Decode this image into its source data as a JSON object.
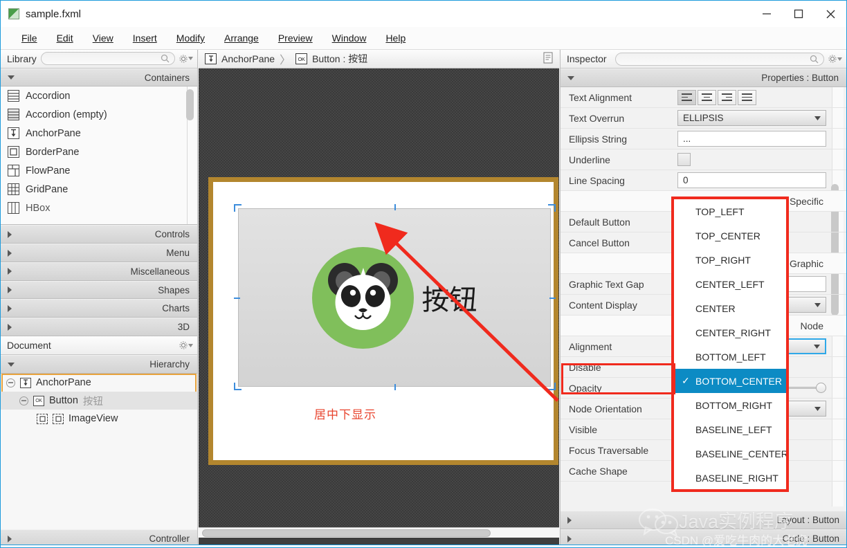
{
  "window": {
    "title": "sample.fxml",
    "icon": "fxml-file-icon",
    "minimize": "—",
    "maximize": "□",
    "close": "✕"
  },
  "menubar": {
    "items": [
      {
        "label": "File"
      },
      {
        "label": "Edit"
      },
      {
        "label": "View"
      },
      {
        "label": "Insert"
      },
      {
        "label": "Modify"
      },
      {
        "label": "Arrange"
      },
      {
        "label": "Preview"
      },
      {
        "label": "Window"
      },
      {
        "label": "Help"
      }
    ]
  },
  "library": {
    "title": "Library",
    "search_placeholder": "",
    "sections": [
      {
        "label": "Containers",
        "expanded": true
      },
      {
        "label": "Controls",
        "expanded": false
      },
      {
        "label": "Menu",
        "expanded": false
      },
      {
        "label": "Miscellaneous",
        "expanded": false
      },
      {
        "label": "Shapes",
        "expanded": false
      },
      {
        "label": "Charts",
        "expanded": false
      },
      {
        "label": "3D",
        "expanded": false
      }
    ],
    "items": [
      {
        "label": "Accordion",
        "icon": "accordion-icon"
      },
      {
        "label": "Accordion  (empty)",
        "icon": "accordion-empty-icon"
      },
      {
        "label": "AnchorPane",
        "icon": "anchorpane-icon"
      },
      {
        "label": "BorderPane",
        "icon": "borderpane-icon"
      },
      {
        "label": "FlowPane",
        "icon": "flowpane-icon"
      },
      {
        "label": "GridPane",
        "icon": "gridpane-icon"
      },
      {
        "label": "HBox",
        "icon": "hbox-icon"
      }
    ]
  },
  "document": {
    "title": "Document",
    "hierarchy_label": "Hierarchy",
    "controller_label": "Controller",
    "tree": [
      {
        "label": "AnchorPane",
        "icon": "anchorpane-icon",
        "suffix": "",
        "indent": 0,
        "selected": false,
        "expander": true
      },
      {
        "label": "Button",
        "icon": "button-ok-icon",
        "suffix": "按钮",
        "indent": 1,
        "selected": true,
        "expander": true
      },
      {
        "label": "ImageView",
        "icon": "imageview-icon",
        "suffix": "",
        "indent": 2,
        "selected": false,
        "expander": false
      }
    ]
  },
  "breadcrumb": {
    "root": "AnchorPane",
    "root_icon": "anchorpane-icon",
    "separator": "〉",
    "leaf": "Button : 按钮",
    "leaf_icon": "button-ok-icon",
    "doc_icon": "document-icon"
  },
  "canvas": {
    "button_text": "按钮",
    "graphic_icon": "panda-icon",
    "annotation": "居中下显示",
    "annotation_color": "#e8442e",
    "stage_border_color": "#b3862e",
    "panda_green": "#80bf5b",
    "selection_handle_color": "#3c8ddc",
    "arrow_color": "#f02a1d"
  },
  "inspector": {
    "title": "Inspector",
    "search_placeholder": "",
    "properties_header": "Properties : Button",
    "rows": [
      {
        "label": "Text Alignment",
        "type": "align-group",
        "value": "left"
      },
      {
        "label": "Text Overrun",
        "type": "combo",
        "value": "ELLIPSIS"
      },
      {
        "label": "Ellipsis String",
        "type": "input",
        "value": "..."
      },
      {
        "label": "Underline",
        "type": "checkbox",
        "value": "false"
      },
      {
        "label": "Line Spacing",
        "type": "input",
        "value": "0"
      }
    ],
    "group_specific": "Specific",
    "specific_rows": [
      {
        "label": "Default Button",
        "type": "checkbox"
      },
      {
        "label": "Cancel Button",
        "type": "checkbox"
      }
    ],
    "group_graphic": "Graphic",
    "graphic_rows": [
      {
        "label": "Graphic Text Gap",
        "type": "input",
        "value": ""
      },
      {
        "label": "Content Display",
        "type": "combo",
        "value": ""
      }
    ],
    "group_node": "Node",
    "node_rows": [
      {
        "label": "Alignment",
        "type": "combo",
        "value": "",
        "focused": true,
        "highlighted": true
      },
      {
        "label": "Disable",
        "type": "checkbox",
        "value": ""
      },
      {
        "label": "Opacity",
        "type": "slider",
        "value": "1"
      },
      {
        "label": "Node Orientation",
        "type": "combo",
        "value": ""
      },
      {
        "label": "Visible",
        "type": "checkbox",
        "value": ""
      },
      {
        "label": "Focus Traversable",
        "type": "checkbox",
        "value": ""
      },
      {
        "label": "Cache Shape",
        "type": "checkbox",
        "value": ""
      }
    ],
    "bottom_sections": [
      {
        "label": "Layout : Button"
      },
      {
        "label": "Code : Button"
      }
    ]
  },
  "dropdown": {
    "name": "alignment-dropdown",
    "selected": "BOTTOM_CENTER",
    "check_glyph": "✓",
    "options": [
      "TOP_LEFT",
      "TOP_CENTER",
      "TOP_RIGHT",
      "CENTER_LEFT",
      "CENTER",
      "CENTER_RIGHT",
      "BOTTOM_LEFT",
      "BOTTOM_CENTER",
      "BOTTOM_RIGHT",
      "BASELINE_LEFT",
      "BASELINE_CENTER",
      "BASELINE_RIGHT"
    ],
    "highlight_color": "#0c8bc4",
    "border_color": "#f02a1d"
  },
  "watermark": {
    "line1": "Java实例程序",
    "line2": "CSDN @爱吃牛肉的大老虎"
  }
}
